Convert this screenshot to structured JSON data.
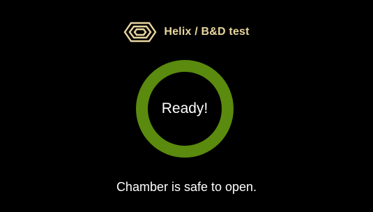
{
  "header": {
    "logo_icon": "hexagon-rings-logo-icon",
    "program_name": "Helix / B&D test"
  },
  "status": {
    "ring_label": "Ready!",
    "message": "Chamber is safe to open."
  },
  "colors": {
    "background": "#000000",
    "accent_gold": "#E9D6A0",
    "ready_green": "#5A8A0E",
    "text": "#FFFFFF"
  }
}
